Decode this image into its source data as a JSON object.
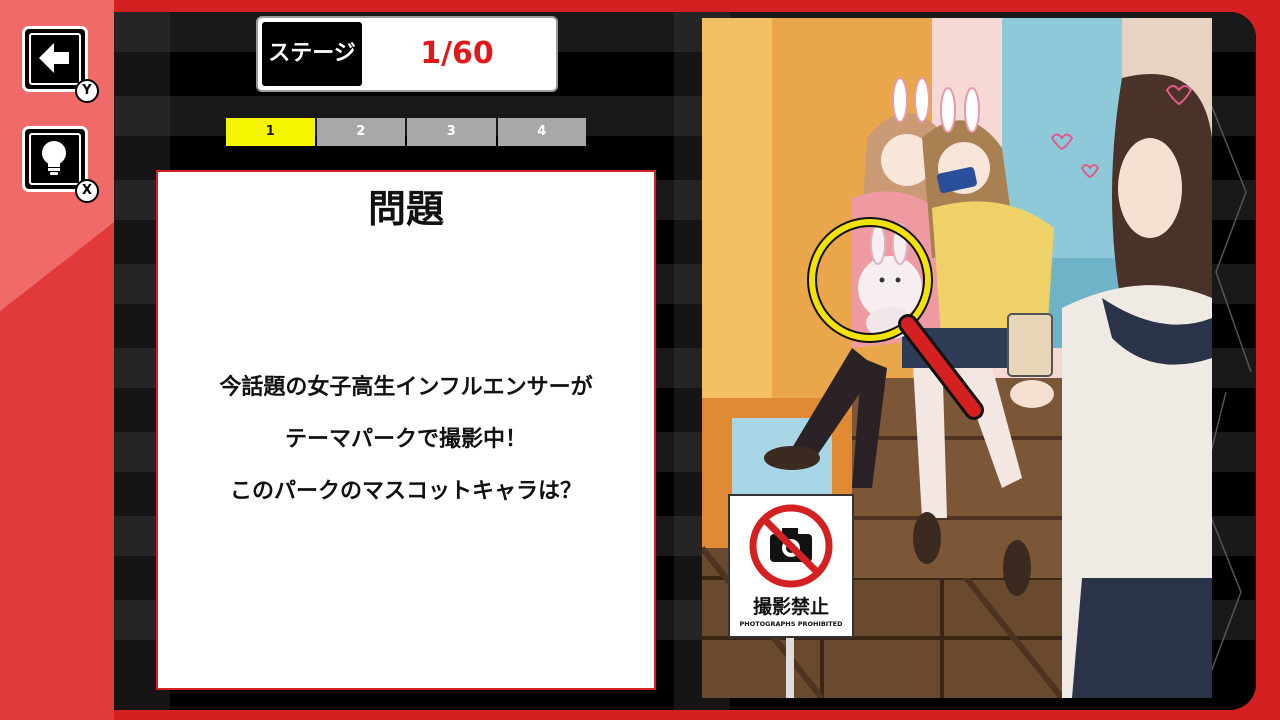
{
  "controls": {
    "back": {
      "icon": "arrow-left-icon",
      "key": "Y"
    },
    "hint": {
      "icon": "lightbulb-icon",
      "key": "X"
    }
  },
  "stage": {
    "label": "ステージ",
    "count": "1/60"
  },
  "tabs": [
    {
      "label": "1",
      "active": true
    },
    {
      "label": "2",
      "active": false
    },
    {
      "label": "3",
      "active": false
    },
    {
      "label": "4",
      "active": false
    }
  ],
  "question": {
    "title": "問題",
    "lines": [
      "今話題の女子高生インフルエンサーが",
      "テーマパークで撮影中！",
      "このパークのマスコットキャラは？"
    ]
  },
  "scene": {
    "sign": {
      "title": "撮影禁止",
      "subtitle": "PHOTOGRAPHS PROHIBITED"
    }
  },
  "colors": {
    "accent_red": "#d42020",
    "tab_active": "#f5f500",
    "tab_inactive": "#a8a8a8",
    "magnifier": "#f2e20a"
  }
}
